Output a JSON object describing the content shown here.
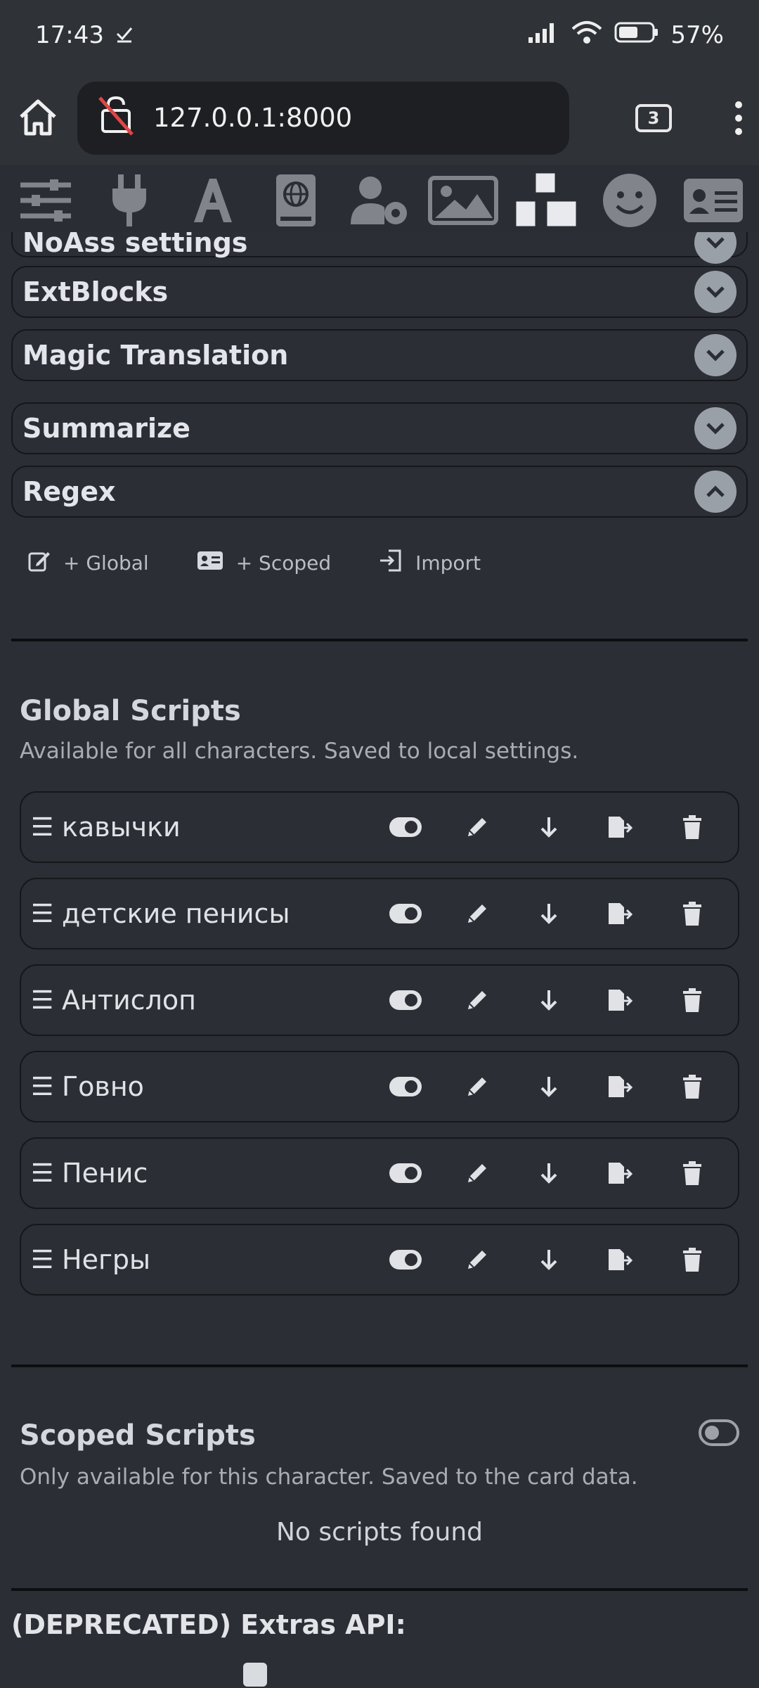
{
  "status": {
    "time": "17:43",
    "battery": "57%"
  },
  "browser": {
    "url": "127.0.0.1:8000",
    "tab_count": "3"
  },
  "toolbar": {
    "icons": [
      "sliders-icon",
      "plug-icon",
      "font-icon",
      "book-globe-icon",
      "user-gear-icon",
      "image-icon",
      "cubes-icon",
      "smile-icon",
      "id-card-icon"
    ]
  },
  "drawers": {
    "noass": "NoAss settings",
    "extblocks": "ExtBlocks",
    "magic": "Magic Translation",
    "summarize": "Summarize",
    "regex": "Regex"
  },
  "regex": {
    "actions": {
      "global": "+ Global",
      "scoped": "+ Scoped",
      "import": "Import"
    },
    "global": {
      "title": "Global Scripts",
      "subtitle": "Available for all characters. Saved to local settings.",
      "scripts": [
        "кавычки",
        "детские пенисы",
        "Антислоп",
        "Говно",
        "Пенис",
        "Негры"
      ]
    },
    "scoped": {
      "title": "Scoped Scripts",
      "subtitle": "Only available for this character. Saved to the card data.",
      "empty": "No scripts found"
    }
  },
  "extras": {
    "title": "(DEPRECATED) Extras API:"
  }
}
